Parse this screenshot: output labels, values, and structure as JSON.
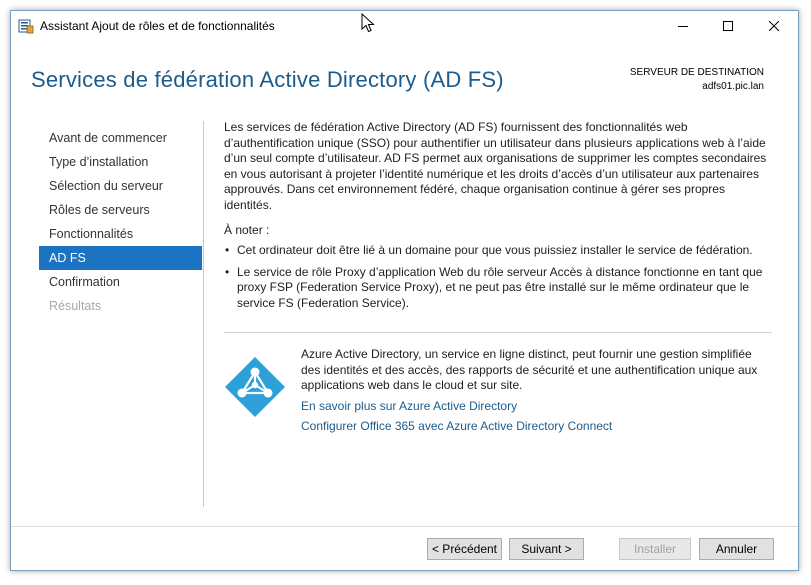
{
  "window": {
    "title": "Assistant Ajout de rôles et de fonctionnalités",
    "icons": {
      "app": "server-manager-icon",
      "minimize": "minimize-icon",
      "maximize": "maximize-icon",
      "close": "close-icon"
    }
  },
  "header": {
    "title": "Services de fédération Active Directory (AD FS)",
    "destination_label": "SERVEUR DE DESTINATION",
    "destination_server": "adfs01.pic.lan"
  },
  "nav": {
    "items": [
      {
        "label": "Avant de commencer",
        "state": "normal"
      },
      {
        "label": "Type d’installation",
        "state": "normal"
      },
      {
        "label": "Sélection du serveur",
        "state": "normal"
      },
      {
        "label": "Rôles de serveurs",
        "state": "normal"
      },
      {
        "label": "Fonctionnalités",
        "state": "normal"
      },
      {
        "label": "AD FS",
        "state": "active"
      },
      {
        "label": "Confirmation",
        "state": "normal"
      },
      {
        "label": "Résultats",
        "state": "disabled"
      }
    ]
  },
  "content": {
    "description": "Les services de fédération Active Directory (AD FS) fournissent des fonctionnalités web d’authentification unique (SSO) pour authentifier un utilisateur dans plusieurs applications web à l’aide d’un seul compte d’utilisateur. AD FS permet aux organisations de supprimer les comptes secondaires en vous autorisant à projeter l’identité numérique et les droits d’accès d’un utilisateur aux partenaires approuvés. Dans cet environnement fédéré, chaque organisation continue à gérer ses propres identités.",
    "note_heading": "À noter :",
    "bullets": [
      "Cet ordinateur doit être lié à un domaine pour que vous puissiez installer le service de fédération.",
      "Le service de rôle Proxy d’application Web du rôle serveur Accès à distance fonctionne en tant que proxy FSP (Federation Service Proxy), et ne peut pas être installé sur le même ordinateur que le service FS (Federation Service)."
    ],
    "bullet_glyph": "•"
  },
  "azure": {
    "icon": "azure-ad-icon",
    "description": "Azure Active Directory, un service en ligne distinct, peut fournir une gestion simplifiée des identités et des accès, des rapports de sécurité et une authentification unique aux applications web dans le cloud et sur site.",
    "link_learn_more": "En savoir plus sur Azure Active Directory",
    "link_configure": "Configurer Office 365 avec Azure Active Directory Connect",
    "color": "#2d9fd9"
  },
  "buttons": {
    "previous": "< Précédent",
    "next": "Suivant >",
    "install": "Installer",
    "cancel": "Annuler"
  },
  "colors": {
    "accent": "#1c73c2",
    "title": "#1c5c8c",
    "link": "#1c5c8c"
  }
}
